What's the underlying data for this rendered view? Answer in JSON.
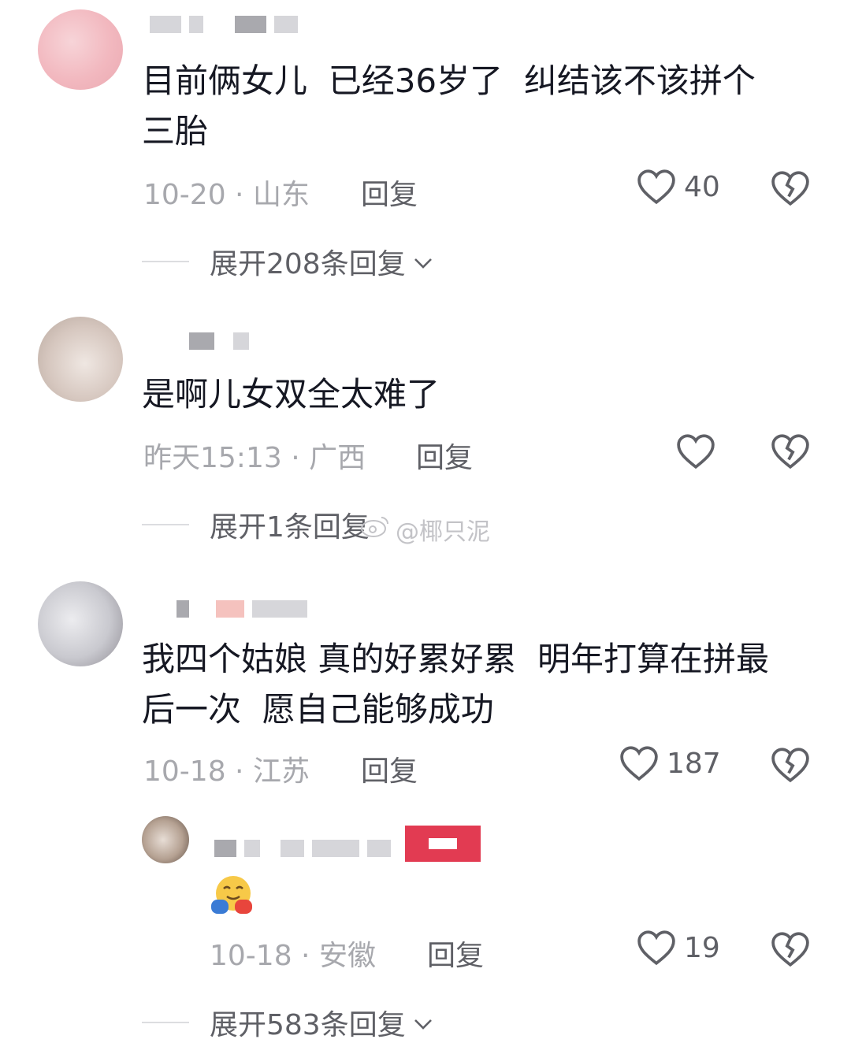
{
  "comments": [
    {
      "text_line1": "目前俩女儿  已经36岁了  纠结该不该拼个",
      "text_line2": "三胎",
      "meta": "10-20 · 山东",
      "reply_label": "回复",
      "likes": "40",
      "expand_label": "展开208条回复"
    },
    {
      "text_line1": "是啊儿女双全太难了",
      "meta": "昨天15:13 · 广西",
      "reply_label": "回复",
      "likes": "",
      "expand_label": "展开1条回复"
    },
    {
      "text_line1": "我四个姑娘 真的好累好累  明年打算在拼最",
      "text_line2": "后一次  愿自己能够成功",
      "meta": "10-18 · 江苏",
      "reply_label": "回复",
      "likes": "187"
    },
    {
      "emoji": "hugging-face-emoji",
      "meta": "10-18 · 安徽",
      "reply_label": "回复",
      "likes": "19",
      "expand_label": "展开583条回复"
    }
  ],
  "watermark": "@椰只泥",
  "colors": {
    "text": "#161823",
    "meta": "#a7a8ad",
    "action": "#5f6066",
    "badge": "#e23b52"
  }
}
